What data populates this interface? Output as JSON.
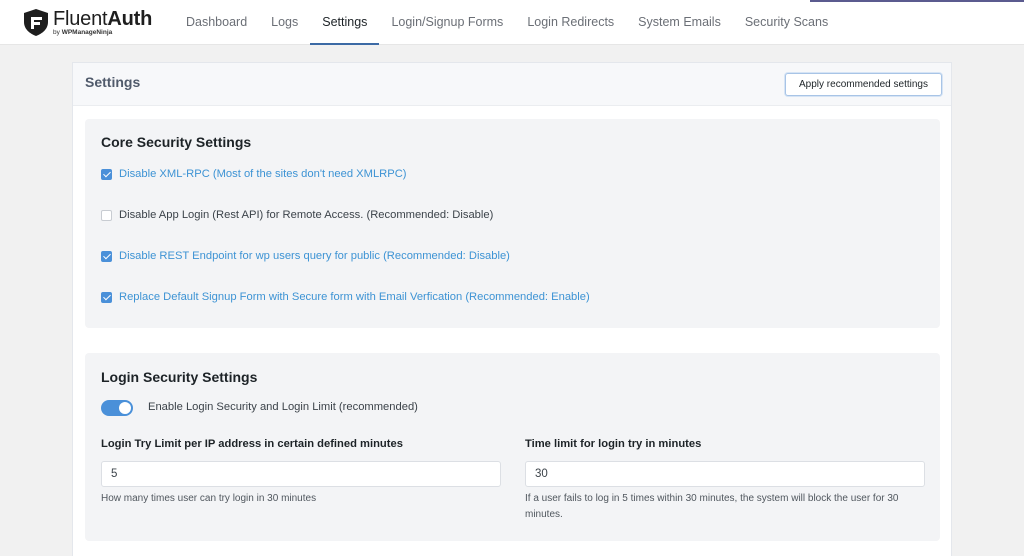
{
  "brand": {
    "name_light": "Fluent",
    "name_bold": "Auth",
    "byline_prefix": "by",
    "byline_company": "WPManageNinja",
    "accent_color": "#4a90d9"
  },
  "nav": {
    "items": [
      {
        "label": "Dashboard",
        "active": false
      },
      {
        "label": "Logs",
        "active": false
      },
      {
        "label": "Settings",
        "active": true
      },
      {
        "label": "Login/Signup Forms",
        "active": false
      },
      {
        "label": "Login Redirects",
        "active": false
      },
      {
        "label": "System Emails",
        "active": false
      },
      {
        "label": "Security Scans",
        "active": false
      }
    ]
  },
  "settings": {
    "title": "Settings",
    "apply_label": "Apply recommended settings"
  },
  "core": {
    "title": "Core Security Settings",
    "options": [
      {
        "label": "Disable XML-RPC (Most of the sites don't need XMLRPC)",
        "checked": true
      },
      {
        "label": "Disable App Login (Rest API) for Remote Access. (Recommended: Disable)",
        "checked": false
      },
      {
        "label": "Disable REST Endpoint for wp users query for public (Recommended: Disable)",
        "checked": true
      },
      {
        "label": "Replace Default Signup Form with Secure form with Email Verfication (Recommended: Enable)",
        "checked": true
      }
    ]
  },
  "login": {
    "title": "Login Security Settings",
    "toggle_label": "Enable Login Security and Login Limit (recommended)",
    "toggle_on": true,
    "try_limit": {
      "label": "Login Try Limit per IP address in certain defined minutes",
      "value": "5",
      "help": "How many times user can try login in 30 minutes"
    },
    "time_limit": {
      "label": "Time limit for login try in minutes",
      "value": "30",
      "help": "If a user fails to log in 5 times within 30 minutes, the system will block the user for 30 minutes."
    }
  }
}
